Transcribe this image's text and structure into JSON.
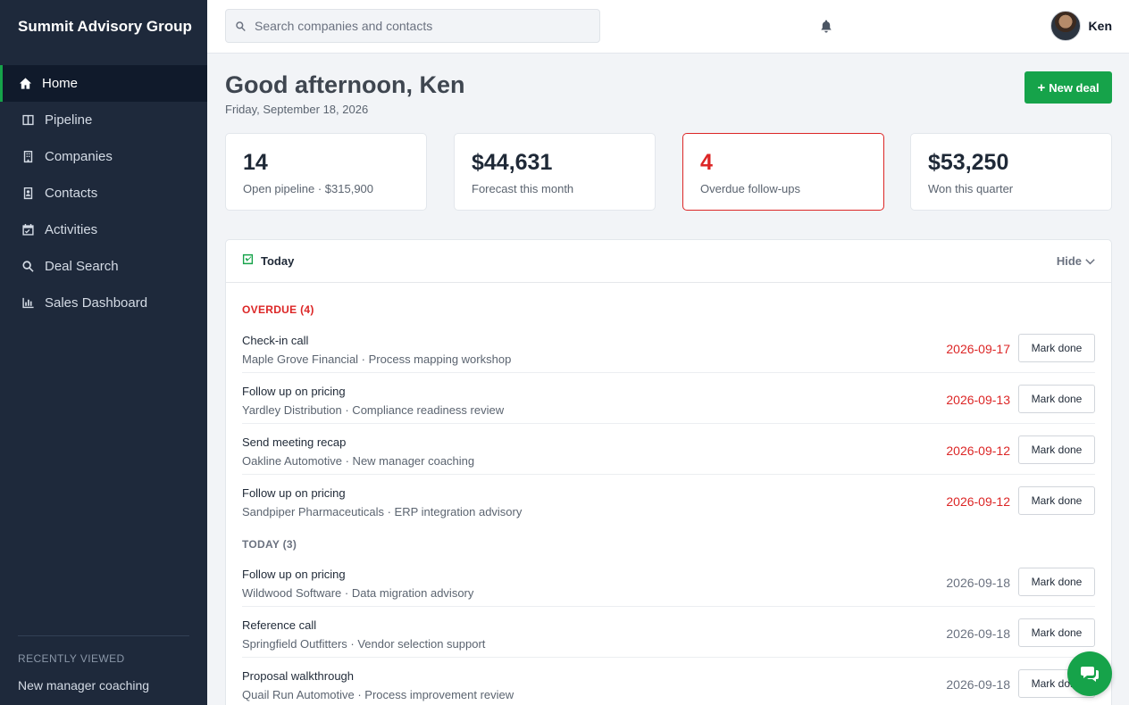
{
  "app": {
    "brand": "Summit Advisory Group"
  },
  "sidebar": {
    "items": [
      {
        "label": "Home",
        "icon": "home-icon",
        "active": true
      },
      {
        "label": "Pipeline",
        "icon": "columns-icon"
      },
      {
        "label": "Companies",
        "icon": "building-icon"
      },
      {
        "label": "Contacts",
        "icon": "address-book-icon"
      },
      {
        "label": "Activities",
        "icon": "calendar-check-icon"
      },
      {
        "label": "Deal Search",
        "icon": "search-icon"
      },
      {
        "label": "Sales Dashboard",
        "icon": "bar-chart-icon"
      }
    ],
    "recent_title": "RECENTLY VIEWED",
    "recent_items": [
      "New manager coaching"
    ]
  },
  "topbar": {
    "search_placeholder": "Search companies and contacts",
    "user_name": "Ken"
  },
  "header": {
    "greeting": "Good afternoon, Ken",
    "date": "Friday, September 18, 2026",
    "new_deal_label": "New deal"
  },
  "stats": [
    {
      "value": "14",
      "label": "Open pipeline · $315,900"
    },
    {
      "value": "$44,631",
      "label": "Forecast this month"
    },
    {
      "value": "4",
      "label": "Overdue follow-ups",
      "warning": true
    },
    {
      "value": "$53,250",
      "label": "Won this quarter"
    }
  ],
  "today_panel": {
    "title": "Today",
    "hide_label": "Hide",
    "overdue_label": "OVERDUE (4)",
    "today_label": "TODAY (3)",
    "mark_done_label": "Mark done",
    "overdue": [
      {
        "title": "Check-in call",
        "sub": "Maple Grove Financial · Process mapping workshop",
        "date": "2026-09-17"
      },
      {
        "title": "Follow up on pricing",
        "sub": "Yardley Distribution · Compliance readiness review",
        "date": "2026-09-13"
      },
      {
        "title": "Send meeting recap",
        "sub": "Oakline Automotive · New manager coaching",
        "date": "2026-09-12"
      },
      {
        "title": "Follow up on pricing",
        "sub": "Sandpiper Pharmaceuticals · ERP integration advisory",
        "date": "2026-09-12"
      }
    ],
    "today": [
      {
        "title": "Follow up on pricing",
        "sub": "Wildwood Software · Data migration advisory",
        "date": "2026-09-18"
      },
      {
        "title": "Reference call",
        "sub": "Springfield Outfitters · Vendor selection support",
        "date": "2026-09-18"
      },
      {
        "title": "Proposal walkthrough",
        "sub": "Quail Run Automotive · Process improvement review",
        "date": "2026-09-18"
      }
    ]
  },
  "colors": {
    "accent": "#16a34a",
    "danger": "#dc2626",
    "sidebar": "#1e293b"
  }
}
